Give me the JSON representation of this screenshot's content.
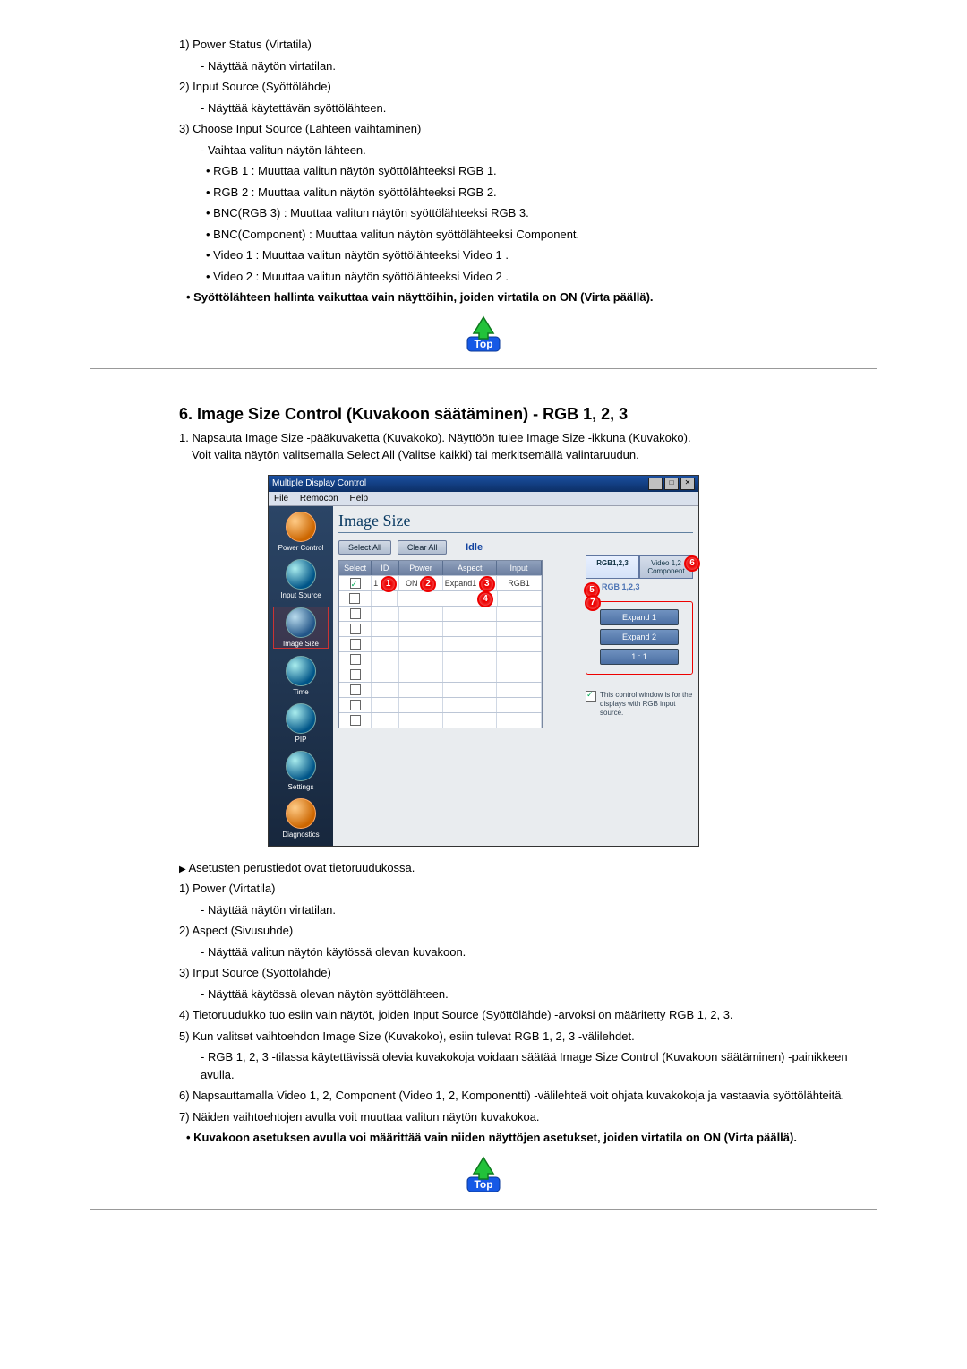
{
  "section_top": {
    "item1_title": "1) Power Status (Virtatila)",
    "item1_desc": "- Näyttää näytön virtatilan.",
    "item2_title": "2) Input Source (Syöttölähde)",
    "item2_desc": "- Näyttää käytettävän syöttölähteen.",
    "item3_title": "3) Choose Input Source (Lähteen vaihtaminen)",
    "item3_desc": "- Vaihtaa valitun näytön lähteen.",
    "item3_rgb1": "• RGB 1 : Muuttaa valitun näytön syöttölähteeksi RGB 1.",
    "item3_rgb2": "• RGB 2 : Muuttaa valitun näytön syöttölähteeksi RGB 2.",
    "item3_bncrgb3": "• BNC(RGB 3) : Muuttaa valitun näytön syöttölähteeksi RGB 3.",
    "item3_bnccomp": "• BNC(Component) : Muuttaa valitun näytön syöttölähteeksi Component.",
    "item3_video1": "• Video 1 : Muuttaa valitun näytön syöttölähteeksi Video 1 .",
    "item3_video2": "• Video 2 : Muuttaa valitun näytön syöttölähteeksi Video 2 .",
    "note": "Syöttölähteen hallinta vaikuttaa vain näyttöihin, joiden virtatila on ON (Virta päällä)."
  },
  "section6": {
    "heading": "6. Image Size Control (Kuvakoon säätäminen) - RGB 1, 2, 3",
    "intro1": "1. Napsauta Image Size -pääkuvaketta (Kuvakoko). Näyttöön tulee Image Size -ikkuna (Kuvakoko).",
    "intro2": "Voit valita näytön valitsemalla Select All (Valitse kaikki) tai merkitsemällä valintaruudun.",
    "after_arrow": "Asetusten perustiedot ovat tietoruudukossa.",
    "p1_title": "1) Power (Virtatila)",
    "p1_desc": "- Näyttää näytön virtatilan.",
    "p2_title": "2) Aspect (Sivusuhde)",
    "p2_desc": "- Näyttää valitun näytön käytössä olevan kuvakoon.",
    "p3_title": "3) Input Source (Syöttölähde)",
    "p3_desc": "- Näyttää käytössä olevan näytön syöttölähteen.",
    "p4": "4) Tietoruudukko tuo esiin vain näytöt, joiden Input Source (Syöttölähde) -arvoksi on määritetty RGB 1, 2, 3.",
    "p5": "5) Kun valitset vaihtoehdon Image Size (Kuvakoko), esiin tulevat RGB 1, 2, 3 -välilehdet.",
    "p5_desc": "- RGB 1, 2, 3 -tilassa käytettävissä olevia kuvakokoja voidaan säätää Image Size Control (Kuvakoon säätäminen) -painikkeen avulla.",
    "p6": "6) Napsauttamalla Video 1, 2, Component (Video 1, 2, Komponentti) -välilehteä voit ohjata kuvakokoja ja vastaavia syöttölähteitä.",
    "p7": "7) Näiden vaihtoehtojen avulla voit muuttaa valitun näytön kuvakokoa.",
    "note": "Kuvakoon asetuksen avulla voi määrittää vain niiden näyttöjen asetukset, joiden virtatila on ON (Virta päällä)."
  },
  "app": {
    "title": "Multiple Display Control",
    "menu_file": "File",
    "menu_remocon": "Remocon",
    "menu_help": "Help",
    "sidebar": {
      "power": "Power Control",
      "input": "Input Source",
      "image": "Image Size",
      "time": "Time",
      "pip": "PIP",
      "settings": "Settings",
      "diag": "Diagnostics"
    },
    "panel_title": "Image Size",
    "btn_select_all": "Select All",
    "btn_clear_all": "Clear All",
    "status": "Idle",
    "grid": {
      "h_select": "Select",
      "h_id": "ID",
      "h_power": "Power",
      "h_aspect": "Aspect",
      "h_input": "Input",
      "row1": {
        "id": "1",
        "power": "ON",
        "aspect": "Expand1",
        "input": "RGB1"
      }
    },
    "tab_rgb": "RGB1,2,3",
    "tab_video": "Video 1,2 Component",
    "sub_label": "RGB 1,2,3",
    "opt_expand1": "Expand 1",
    "opt_expand2": "Expand 2",
    "opt_11": "1 : 1",
    "info_text": "This control window is for the displays with RGB input source.",
    "markers": {
      "m1": "1",
      "m2": "2",
      "m3": "3",
      "m4": "4",
      "m5": "5",
      "m6": "6",
      "m7": "7"
    }
  },
  "top_label": "Top"
}
